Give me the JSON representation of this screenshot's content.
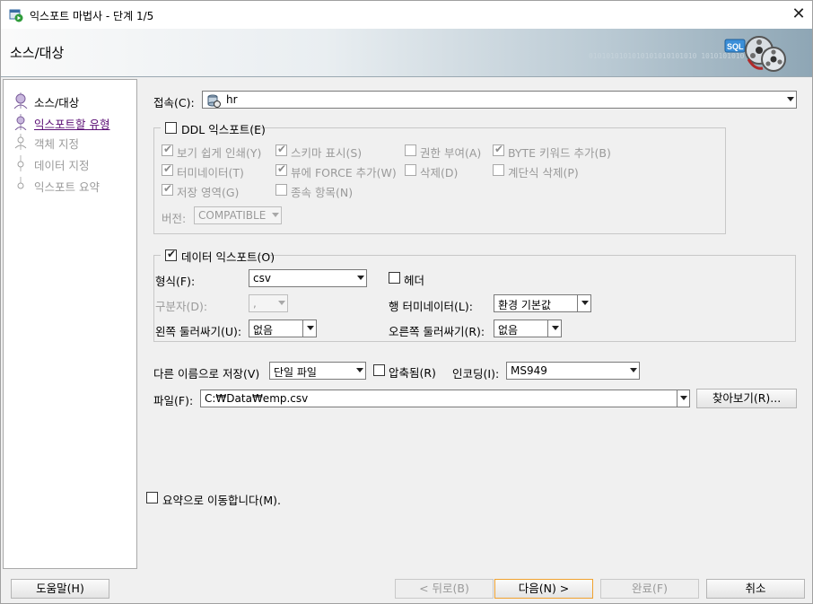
{
  "window": {
    "title": "익스포트 마법사 - 단계 1/5",
    "header_title": "소스/대상",
    "binary_text": "0101010101010101010101010 1010101010"
  },
  "steps": [
    {
      "label": "소스/대상",
      "state": "current"
    },
    {
      "label": "익스포트할 유형",
      "state": "link"
    },
    {
      "label": "객체 지정",
      "state": "disabled"
    },
    {
      "label": "데이터 지정",
      "state": "disabled"
    },
    {
      "label": "익스포트 요약",
      "state": "disabled"
    }
  ],
  "connection": {
    "label": "접속(C):",
    "value": "hr"
  },
  "ddl": {
    "label": "DDL 익스포트(E)",
    "checked": false,
    "options": [
      {
        "label": "보기 쉽게 인쇄(Y)",
        "checked": true
      },
      {
        "label": "스키마 표시(S)",
        "checked": true
      },
      {
        "label": "권한 부여(A)",
        "checked": false
      },
      {
        "label": "BYTE 키워드 추가(B)",
        "checked": true
      },
      {
        "label": "터미네이터(T)",
        "checked": true
      },
      {
        "label": "뷰에 FORCE 추가(W)",
        "checked": true
      },
      {
        "label": "삭제(D)",
        "checked": false
      },
      {
        "label": "계단식 삭제(P)",
        "checked": false
      },
      {
        "label": "저장 영역(G)",
        "checked": true
      },
      {
        "label": "종속 항목(N)",
        "checked": false
      }
    ],
    "version_label": "버전:",
    "version_value": "COMPATIBLE"
  },
  "data_export": {
    "label": "데이터 익스포트(O)",
    "checked": true,
    "format_label": "형식(F):",
    "format_value": "csv",
    "header_label": "헤더",
    "header_checked": false,
    "delimiter_label": "구분자(D):",
    "delimiter_value": ",",
    "line_terminator_label": "행 터미네이터(L):",
    "line_terminator_value": "환경 기본값",
    "left_enclosure_label": "왼쪽 둘러싸기(U):",
    "left_enclosure_value": "없음",
    "right_enclosure_label": "오른쪽 둘러싸기(R):",
    "right_enclosure_value": "없음"
  },
  "save": {
    "save_as_label": "다른 이름으로 저장(V)",
    "save_as_value": "단일 파일",
    "compressed_label": "압축됨(R)",
    "compressed_checked": false,
    "encoding_label": "인코딩(I):",
    "encoding_value": "MS949",
    "file_label": "파일(F):",
    "file_value": "C:₩Data₩emp.csv",
    "browse_label": "찾아보기(R)..."
  },
  "summary_jump": {
    "label": "요약으로 이동합니다(M).",
    "checked": false
  },
  "buttons": {
    "help": "도움말(H)",
    "back": "< 뒤로(B)",
    "next": "다음(N) >",
    "finish": "완료(F)",
    "cancel": "취소"
  }
}
